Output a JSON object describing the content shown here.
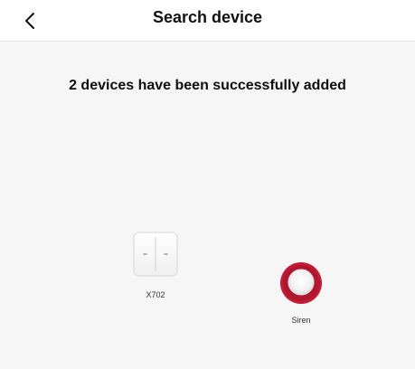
{
  "header": {
    "title": "Search device",
    "back_icon": "chevron-left-icon"
  },
  "status": {
    "message": "2 devices have been successfully added"
  },
  "devices": [
    {
      "label": "X702",
      "icon": "wall-switch-icon"
    },
    {
      "label": "Siren",
      "icon": "siren-icon",
      "accent_color": "#c41a35"
    }
  ]
}
